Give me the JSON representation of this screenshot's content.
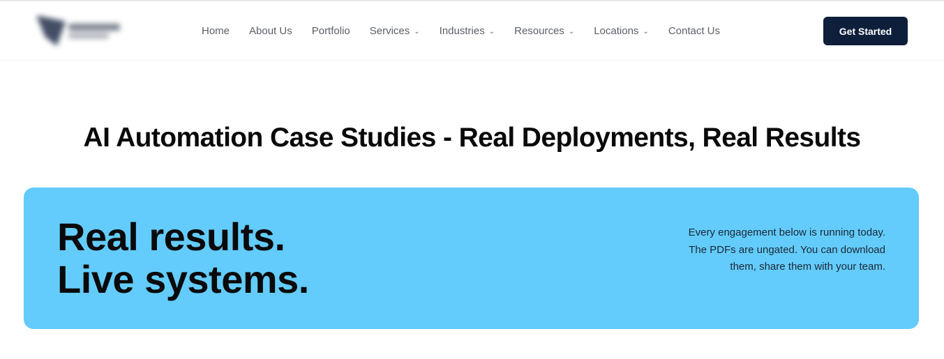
{
  "header": {
    "logo_alt": "company logo",
    "menu": [
      {
        "label": "Home",
        "has_dropdown": false
      },
      {
        "label": "About Us",
        "has_dropdown": false
      },
      {
        "label": "Portfolio",
        "has_dropdown": false
      },
      {
        "label": "Services",
        "has_dropdown": true
      },
      {
        "label": "Industries",
        "has_dropdown": true
      },
      {
        "label": "Resources",
        "has_dropdown": true
      },
      {
        "label": "Locations",
        "has_dropdown": true
      },
      {
        "label": "Contact Us",
        "has_dropdown": false
      }
    ],
    "cta_label": "Get Started",
    "chevron_glyph": "⌄"
  },
  "page": {
    "title": "AI Automation Case Studies - Real Deployments, Real Results"
  },
  "hero": {
    "line1": "Real results.",
    "line2": "Live systems.",
    "description": "Every engagement below is running today. The PDFs are ungated. You can download them, share them with your team."
  },
  "colors": {
    "hero_bg": "#63ccfd",
    "cta_bg": "#0e1f3b",
    "nav_text": "#5a5f66"
  }
}
